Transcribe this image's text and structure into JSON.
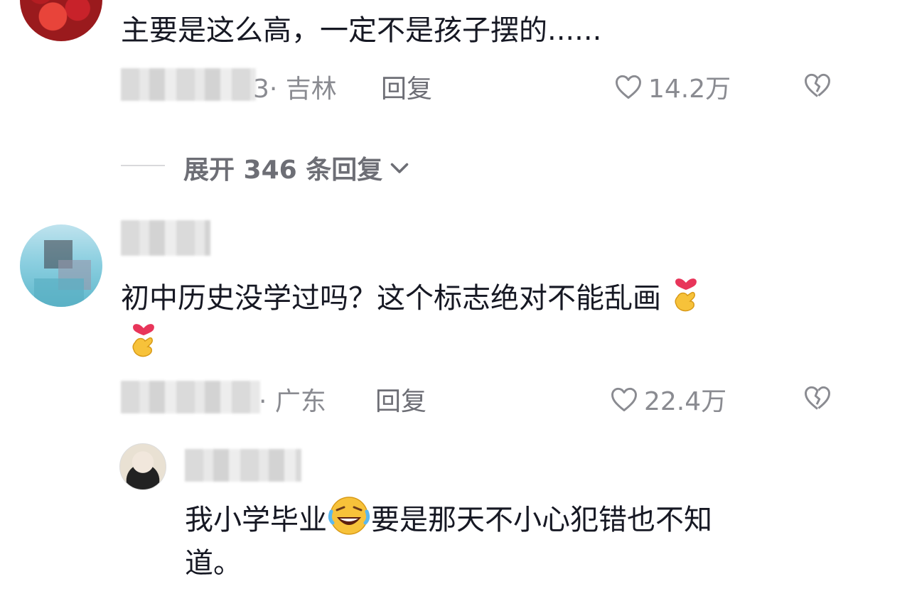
{
  "comments": [
    {
      "text": "主要是这么高，一定不是孩子摆的......",
      "meta": "3· 吉林",
      "reply_label": "回复",
      "likes": "14.2万"
    },
    {
      "text_line1": "初中历史没学过吗？这个标志绝对不能乱画",
      "meta": "· 广东",
      "reply_label": "回复",
      "likes": "22.4万"
    }
  ],
  "expand_replies": "展开 346 条回复",
  "sub_reply": {
    "text_line1_a": "我小学毕业",
    "text_line1_b": "要是那天不小心犯错也不知",
    "text_line2": "道。"
  },
  "icons": {
    "like": "heart-outline-icon",
    "dislike": "broken-heart-icon",
    "expand": "chevron-down-icon",
    "emoji_finger_heart": "finger-heart-emoji",
    "emoji_laugh_cry": "rolling-laughing-emoji"
  },
  "colors": {
    "text": "#161823",
    "meta": "#8a8b91",
    "reply": "#6d6e75"
  }
}
